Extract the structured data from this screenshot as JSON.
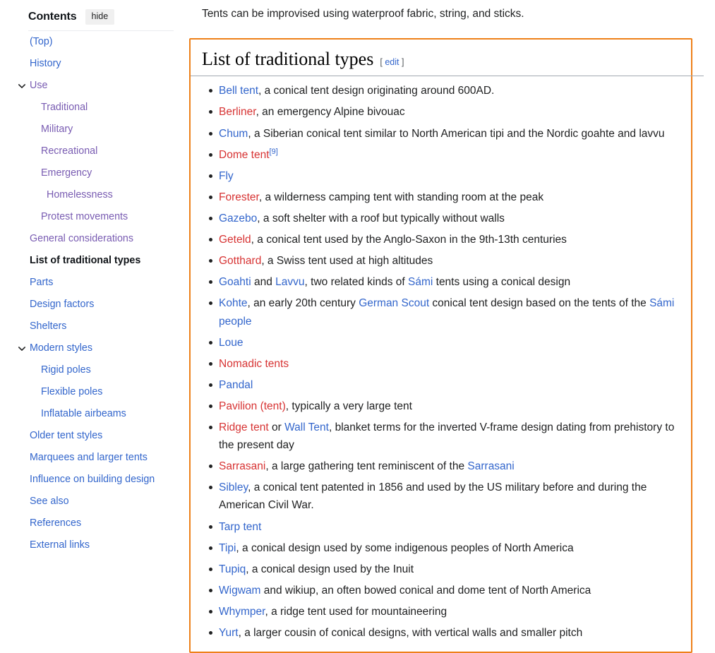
{
  "sidebar": {
    "title": "Contents",
    "hide_label": "hide",
    "items": [
      {
        "label": "(Top)",
        "level": 1,
        "state": "blue",
        "chevron": false
      },
      {
        "label": "History",
        "level": 1,
        "state": "blue",
        "chevron": false
      },
      {
        "label": "Use",
        "level": 1,
        "state": "purple",
        "chevron": true
      },
      {
        "label": "Traditional",
        "level": 2,
        "state": "purple",
        "chevron": false
      },
      {
        "label": "Military",
        "level": 2,
        "state": "purple",
        "chevron": false
      },
      {
        "label": "Recreational",
        "level": 2,
        "state": "purple",
        "chevron": false
      },
      {
        "label": "Emergency",
        "level": 2,
        "state": "purple",
        "chevron": false
      },
      {
        "label": "Homelessness",
        "level": 3,
        "state": "purple",
        "chevron": false
      },
      {
        "label": "Protest movements",
        "level": 2,
        "state": "purple",
        "chevron": false
      },
      {
        "label": "General considerations",
        "level": 1,
        "state": "purple",
        "chevron": false
      },
      {
        "label": "List of traditional types",
        "level": 1,
        "state": "current",
        "chevron": false
      },
      {
        "label": "Parts",
        "level": 1,
        "state": "blue",
        "chevron": false
      },
      {
        "label": "Design factors",
        "level": 1,
        "state": "blue",
        "chevron": false
      },
      {
        "label": "Shelters",
        "level": 1,
        "state": "blue",
        "chevron": false
      },
      {
        "label": "Modern styles",
        "level": 1,
        "state": "blue",
        "chevron": true
      },
      {
        "label": "Rigid poles",
        "level": 2,
        "state": "blue",
        "chevron": false
      },
      {
        "label": "Flexible poles",
        "level": 2,
        "state": "blue",
        "chevron": false
      },
      {
        "label": "Inflatable airbeams",
        "level": 2,
        "state": "blue",
        "chevron": false
      },
      {
        "label": "Older tent styles",
        "level": 1,
        "state": "blue",
        "chevron": false
      },
      {
        "label": "Marquees and larger tents",
        "level": 1,
        "state": "blue",
        "chevron": false
      },
      {
        "label": "Influence on building design",
        "level": 1,
        "state": "blue",
        "chevron": false
      },
      {
        "label": "See also",
        "level": 1,
        "state": "blue",
        "chevron": false
      },
      {
        "label": "References",
        "level": 1,
        "state": "blue",
        "chevron": false
      },
      {
        "label": "External links",
        "level": 1,
        "state": "blue",
        "chevron": false
      }
    ]
  },
  "content": {
    "lead_paragraph": "Tents can be improvised using waterproof fabric, string, and sticks.",
    "section": {
      "heading": "List of traditional types",
      "edit_bracket_open": "[",
      "edit_label": "edit",
      "edit_bracket_close": "]",
      "items": [
        {
          "parts": [
            {
              "t": "Bell tent",
              "k": "link"
            },
            {
              "t": ", a conical tent design originating around 600AD.",
              "k": "text"
            }
          ]
        },
        {
          "parts": [
            {
              "t": "Berliner",
              "k": "redlink"
            },
            {
              "t": ", an emergency Alpine bivouac",
              "k": "text"
            }
          ]
        },
        {
          "parts": [
            {
              "t": "Chum",
              "k": "link"
            },
            {
              "t": ", a Siberian conical tent similar to North American tipi and the Nordic goahte and lavvu",
              "k": "text"
            }
          ]
        },
        {
          "parts": [
            {
              "t": "Dome tent",
              "k": "redlink"
            },
            {
              "t": "[9]",
              "k": "ref"
            }
          ]
        },
        {
          "parts": [
            {
              "t": "Fly",
              "k": "link"
            }
          ]
        },
        {
          "parts": [
            {
              "t": "Forester",
              "k": "redlink"
            },
            {
              "t": ", a wilderness camping tent with standing room at the peak",
              "k": "text"
            }
          ]
        },
        {
          "parts": [
            {
              "t": "Gazebo",
              "k": "link"
            },
            {
              "t": ", a soft shelter with a roof but typically without walls",
              "k": "text"
            }
          ]
        },
        {
          "parts": [
            {
              "t": "Geteld",
              "k": "redlink"
            },
            {
              "t": ", a conical tent used by the Anglo-Saxon in the 9th-13th centuries",
              "k": "text"
            }
          ]
        },
        {
          "parts": [
            {
              "t": "Gotthard",
              "k": "redlink"
            },
            {
              "t": ", a Swiss tent used at high altitudes",
              "k": "text"
            }
          ]
        },
        {
          "parts": [
            {
              "t": "Goahti",
              "k": "link"
            },
            {
              "t": " and ",
              "k": "text"
            },
            {
              "t": "Lavvu",
              "k": "link"
            },
            {
              "t": ", two related kinds of ",
              "k": "text"
            },
            {
              "t": "Sámi",
              "k": "link"
            },
            {
              "t": " tents using a conical design",
              "k": "text"
            }
          ]
        },
        {
          "parts": [
            {
              "t": "Kohte",
              "k": "link"
            },
            {
              "t": ", an early 20th century ",
              "k": "text"
            },
            {
              "t": "German Scout",
              "k": "link"
            },
            {
              "t": " conical tent design based on the tents of the ",
              "k": "text"
            },
            {
              "t": "Sámi people",
              "k": "link"
            }
          ]
        },
        {
          "parts": [
            {
              "t": "Loue",
              "k": "link"
            }
          ]
        },
        {
          "parts": [
            {
              "t": "Nomadic tents",
              "k": "redlink"
            }
          ]
        },
        {
          "parts": [
            {
              "t": "Pandal",
              "k": "link"
            }
          ]
        },
        {
          "parts": [
            {
              "t": "Pavilion (tent)",
              "k": "redlink"
            },
            {
              "t": ", typically a very large tent",
              "k": "text"
            }
          ]
        },
        {
          "parts": [
            {
              "t": "Ridge tent",
              "k": "redlink"
            },
            {
              "t": " or ",
              "k": "text"
            },
            {
              "t": "Wall Tent",
              "k": "link"
            },
            {
              "t": ", blanket terms for the inverted V-frame design dating from prehistory to the present day",
              "k": "text"
            }
          ]
        },
        {
          "parts": [
            {
              "t": "Sarrasani",
              "k": "redlink"
            },
            {
              "t": ", a large gathering tent reminiscent of the ",
              "k": "text"
            },
            {
              "t": "Sarrasani",
              "k": "link"
            }
          ]
        },
        {
          "parts": [
            {
              "t": "Sibley",
              "k": "link"
            },
            {
              "t": ", a conical tent patented in 1856 and used by the US military before and during the American Civil War.",
              "k": "text"
            }
          ]
        },
        {
          "parts": [
            {
              "t": "Tarp tent",
              "k": "link"
            }
          ]
        },
        {
          "parts": [
            {
              "t": "Tipi",
              "k": "link"
            },
            {
              "t": ", a conical design used by some indigenous peoples of North America",
              "k": "text"
            }
          ]
        },
        {
          "parts": [
            {
              "t": "Tupiq",
              "k": "link"
            },
            {
              "t": ", a conical design used by the Inuit",
              "k": "text"
            }
          ]
        },
        {
          "parts": [
            {
              "t": "Wigwam",
              "k": "link"
            },
            {
              "t": " and wikiup, an often bowed conical and dome tent of North America",
              "k": "text"
            }
          ]
        },
        {
          "parts": [
            {
              "t": "Whymper",
              "k": "link"
            },
            {
              "t": ", a ridge tent used for mountaineering",
              "k": "text"
            }
          ]
        },
        {
          "parts": [
            {
              "t": "Yurt",
              "k": "link"
            },
            {
              "t": ", a larger cousin of conical designs, with vertical walls and smaller pitch",
              "k": "text"
            }
          ]
        }
      ]
    }
  },
  "colors": {
    "link_blue": "#3366cc",
    "link_red": "#d73333",
    "link_visited": "#795cb2",
    "highlight_orange": "#ee8019"
  }
}
